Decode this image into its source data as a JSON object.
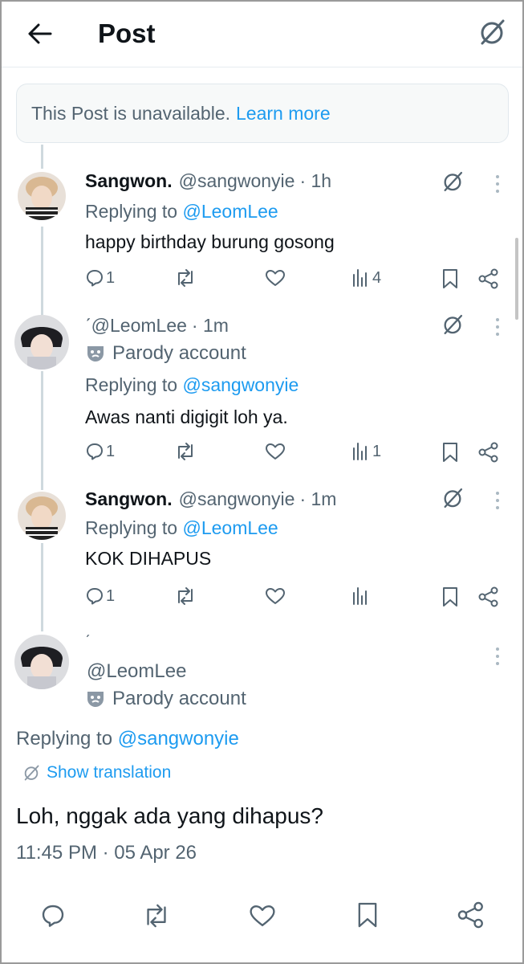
{
  "header": {
    "title": "Post",
    "back_icon": "arrow-left-icon",
    "grok_icon": "grok-icon"
  },
  "banner": {
    "text": "This Post is unavailable.",
    "link": "Learn more"
  },
  "replies": [
    {
      "name": "Sangwon.",
      "handle": "@sangwonyie",
      "time": "· 1h",
      "replying_label": "Replying to",
      "replying_to": "@LeomLee",
      "text": "happy birthday burung gosong",
      "reply_count": "1",
      "views": "4"
    },
    {
      "name": "",
      "handle": "ˊ@LeomLee",
      "time": "· 1m",
      "parody": "Parody account",
      "replying_label": "Replying to",
      "replying_to": "@sangwonyie",
      "text": "Awas nanti digigit loh ya.",
      "reply_count": "1",
      "views": "1"
    },
    {
      "name": "Sangwon.",
      "handle": "@sangwonyie",
      "time": "· 1m",
      "replying_label": "Replying to",
      "replying_to": "@LeomLee",
      "text": "KOK DIHAPUS",
      "reply_count": "1",
      "views": ""
    }
  ],
  "main_post": {
    "name": "ˊ",
    "handle": "@LeomLee",
    "parody": "Parody account",
    "replying_label": "Replying to",
    "replying_to": "@sangwonyie",
    "translate": "Show translation",
    "text": "Loh, nggak ada yang dihapus?",
    "timestamp": "11:45 PM · 05 Apr 26"
  },
  "colors": {
    "accent": "#1d9bf0",
    "secondary_text": "#536471",
    "primary_text": "#0f1419",
    "border": "#e1e8ed"
  }
}
